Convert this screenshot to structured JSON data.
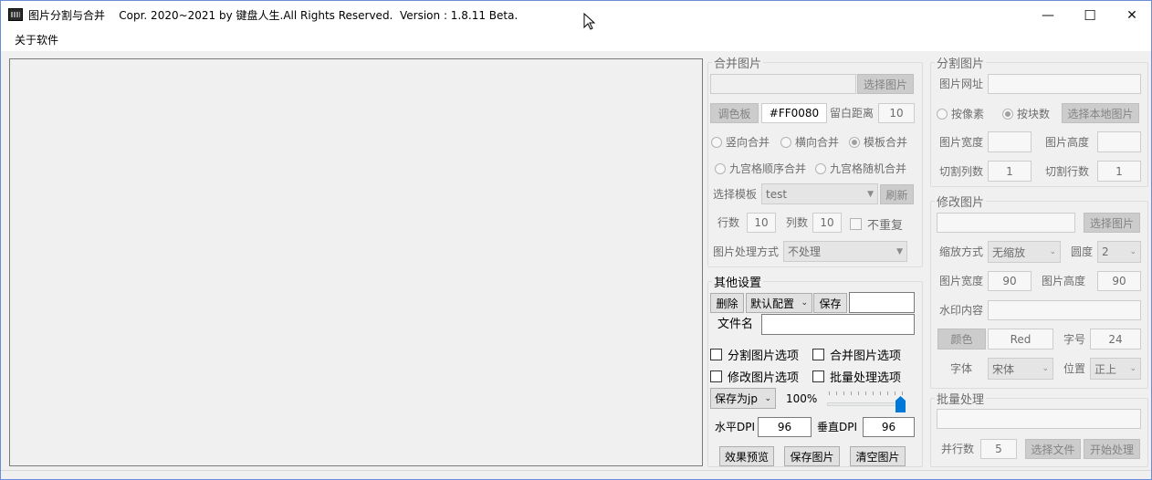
{
  "window": {
    "title": "图片分割与合并    Copr. 2020~2021 by 键盘人生.All Rights Reserved.  Version : 1.8.11 Beta.",
    "controls": {
      "minimize": "—",
      "maximize": "☐",
      "close": "✕"
    }
  },
  "menu": {
    "items": [
      "关于软件"
    ]
  },
  "merge": {
    "legend": "合并图片",
    "select_button": "选择图片",
    "palette_button": "调色板",
    "color_value": "#FF0080",
    "margin_label": "留白距离",
    "margin_value": "10",
    "mode_radios": [
      "竖向合并",
      "横向合并",
      "模板合并"
    ],
    "grid_radios": [
      "九宫格顺序合并",
      "九宫格随机合并"
    ],
    "template_label": "选择模板",
    "template_value": "test",
    "refresh_button": "刷新",
    "rows_label": "行数",
    "rows_value": "10",
    "cols_label": "列数",
    "cols_value": "10",
    "no_repeat_label": "不重复",
    "process_label": "图片处理方式",
    "process_value": "不处理"
  },
  "other": {
    "legend": "其他设置",
    "delete_button": "删除",
    "preset_value": "默认配置",
    "save_button": "保存",
    "filename_label": "文件名",
    "options": [
      "分割图片选项",
      "合并图片选项",
      "修改图片选项",
      "批量处理选项"
    ],
    "save_as_value": "保存为jp",
    "quality": "100%",
    "quality_level": 1.0,
    "hdpi_label": "水平DPI",
    "hdpi_value": "96",
    "vdpi_label": "垂直DPI",
    "vdpi_value": "96",
    "preview_button": "效果预览",
    "save_image_button": "保存图片",
    "clear_button": "清空图片"
  },
  "split": {
    "legend": "分割图片",
    "url_label": "图片网址",
    "by_pixel": "按像素",
    "by_block": "按块数",
    "select_local_button": "选择本地图片",
    "width_label": "图片宽度",
    "height_label": "图片高度",
    "cols_label": "切割列数",
    "cols_value": "1",
    "rows_label": "切割行数",
    "rows_value": "1"
  },
  "modify": {
    "legend": "修改图片",
    "select_button": "选择图片",
    "scale_label": "缩放方式",
    "scale_value": "无缩放",
    "radius_label": "圆度",
    "radius_value": "2",
    "width_label": "图片宽度",
    "width_value": "90",
    "height_label": "图片高度",
    "height_value": "90",
    "watermark_label": "水印内容",
    "color_button": "颜色",
    "color_value": "Red",
    "fontsize_label": "字号",
    "fontsize_value": "24",
    "font_label": "字体",
    "font_value": "宋体",
    "position_label": "位置",
    "position_value": "正上"
  },
  "batch": {
    "legend": "批量处理",
    "threads_label": "并行数",
    "threads_value": "5",
    "select_files_button": "选择文件",
    "start_button": "开始处理"
  }
}
